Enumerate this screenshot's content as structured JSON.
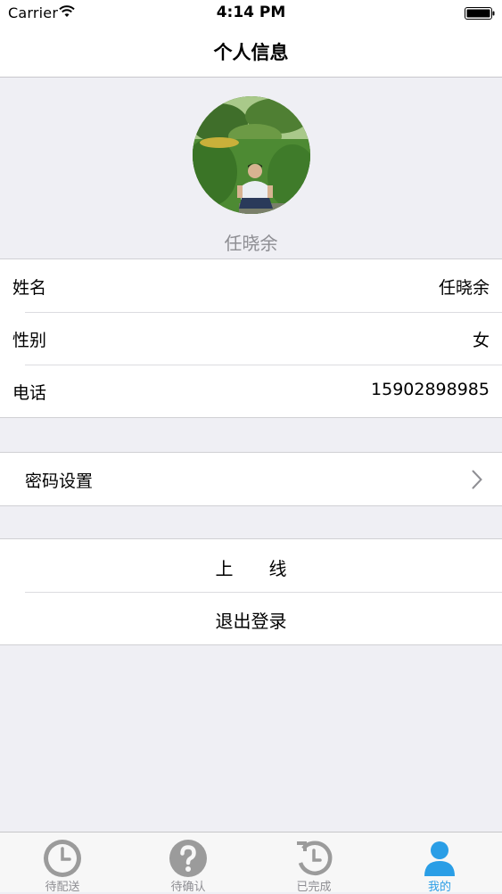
{
  "status_bar": {
    "carrier": "Carrier",
    "time": "4:14 PM"
  },
  "nav": {
    "title": "个人信息"
  },
  "profile": {
    "name": "任晓余"
  },
  "info": {
    "name_label": "姓名",
    "name_value": "任晓余",
    "gender_label": "性别",
    "gender_value": "女",
    "phone_label": "电话",
    "phone_value": "15902898985"
  },
  "settings": {
    "password_label": "密码设置"
  },
  "actions": {
    "online_label": "上　　线",
    "logout_label": "退出登录"
  },
  "tabs": [
    {
      "label": "待配送",
      "icon": "clock-icon"
    },
    {
      "label": "待确认",
      "icon": "question-icon"
    },
    {
      "label": "已完成",
      "icon": "history-icon"
    },
    {
      "label": "我的",
      "icon": "user-icon"
    }
  ],
  "colors": {
    "accent": "#2a9ee6",
    "inactive": "#8e8e93",
    "background": "#efeff4"
  }
}
